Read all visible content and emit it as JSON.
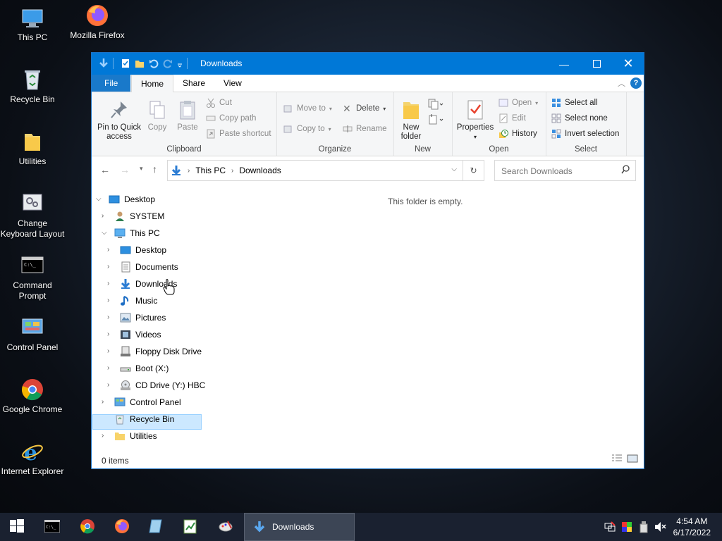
{
  "desktop_icons": [
    {
      "label": "This PC",
      "icon": "this-pc-icon"
    },
    {
      "label": "Mozilla Firefox",
      "icon": "firefox-icon"
    },
    {
      "label": "Recycle Bin",
      "icon": "recycle-bin-icon"
    },
    {
      "label": "Utilities",
      "icon": "folder-icon"
    },
    {
      "label": "Change Keyboard Layout",
      "icon": "keyboard-settings-icon"
    },
    {
      "label": "Command Prompt",
      "icon": "command-prompt-icon"
    },
    {
      "label": "Control Panel",
      "icon": "control-panel-icon"
    },
    {
      "label": "Google Chrome",
      "icon": "chrome-icon"
    },
    {
      "label": "Internet Explorer",
      "icon": "internet-explorer-icon"
    }
  ],
  "window": {
    "title": "Downloads",
    "tabs": {
      "file": "File",
      "home": "Home",
      "share": "Share",
      "view": "View"
    },
    "ribbon": {
      "clipboard": {
        "label": "Clipboard",
        "pin": "Pin to Quick access",
        "copy": "Copy",
        "paste": "Paste",
        "cut": "Cut",
        "copy_path": "Copy path",
        "paste_shortcut": "Paste shortcut"
      },
      "organize": {
        "label": "Organize",
        "move_to": "Move to",
        "copy_to": "Copy to",
        "delete": "Delete",
        "rename": "Rename"
      },
      "new": {
        "label": "New",
        "new_folder": "New folder"
      },
      "open": {
        "label": "Open",
        "properties": "Properties",
        "open": "Open",
        "edit": "Edit",
        "history": "History"
      },
      "select": {
        "label": "Select",
        "select_all": "Select all",
        "select_none": "Select none",
        "invert": "Invert selection"
      }
    },
    "address": {
      "crumbs": [
        "This PC",
        "Downloads"
      ],
      "search_placeholder": "Search Downloads"
    },
    "nav_tree": [
      {
        "label": "Desktop",
        "expanded": true
      },
      {
        "label": "SYSTEM"
      },
      {
        "label": "This PC",
        "expanded": true
      },
      {
        "label": "Desktop"
      },
      {
        "label": "Documents"
      },
      {
        "label": "Downloads",
        "selected": true
      },
      {
        "label": "Music"
      },
      {
        "label": "Pictures"
      },
      {
        "label": "Videos"
      },
      {
        "label": "Floppy Disk Drive"
      },
      {
        "label": "Boot (X:)"
      },
      {
        "label": "CD Drive (Y:) HBC"
      },
      {
        "label": "Control Panel"
      },
      {
        "label": "Recycle Bin"
      },
      {
        "label": "Utilities"
      }
    ],
    "empty_message": "This folder is empty.",
    "status": "0 items"
  },
  "taskbar": {
    "active_app": "Downloads",
    "time": "4:54 AM",
    "date": "6/17/2022"
  },
  "colors": {
    "accent": "#0078d7",
    "selection": "#cce8ff",
    "taskbar": "#1a2130"
  }
}
